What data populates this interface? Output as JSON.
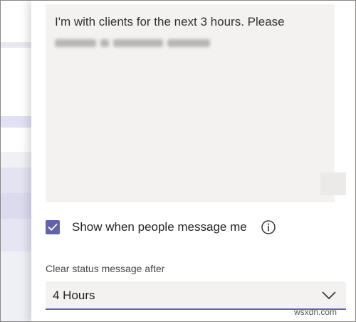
{
  "status_message": {
    "text_line1": "I'm with clients for the next 3 hours. Please",
    "text_line2_blurred": true
  },
  "show_when_message": {
    "label": "Show when people message me",
    "checked": true,
    "info_icon": "info-icon"
  },
  "clear_after": {
    "label": "Clear status message after",
    "selected": "4 Hours",
    "dropdown_icon": "chevron-down-icon"
  },
  "watermark": "wsxdn.com",
  "colors": {
    "accent": "#6264a7",
    "field_bg": "#f3f2f1",
    "text": "#252423"
  }
}
